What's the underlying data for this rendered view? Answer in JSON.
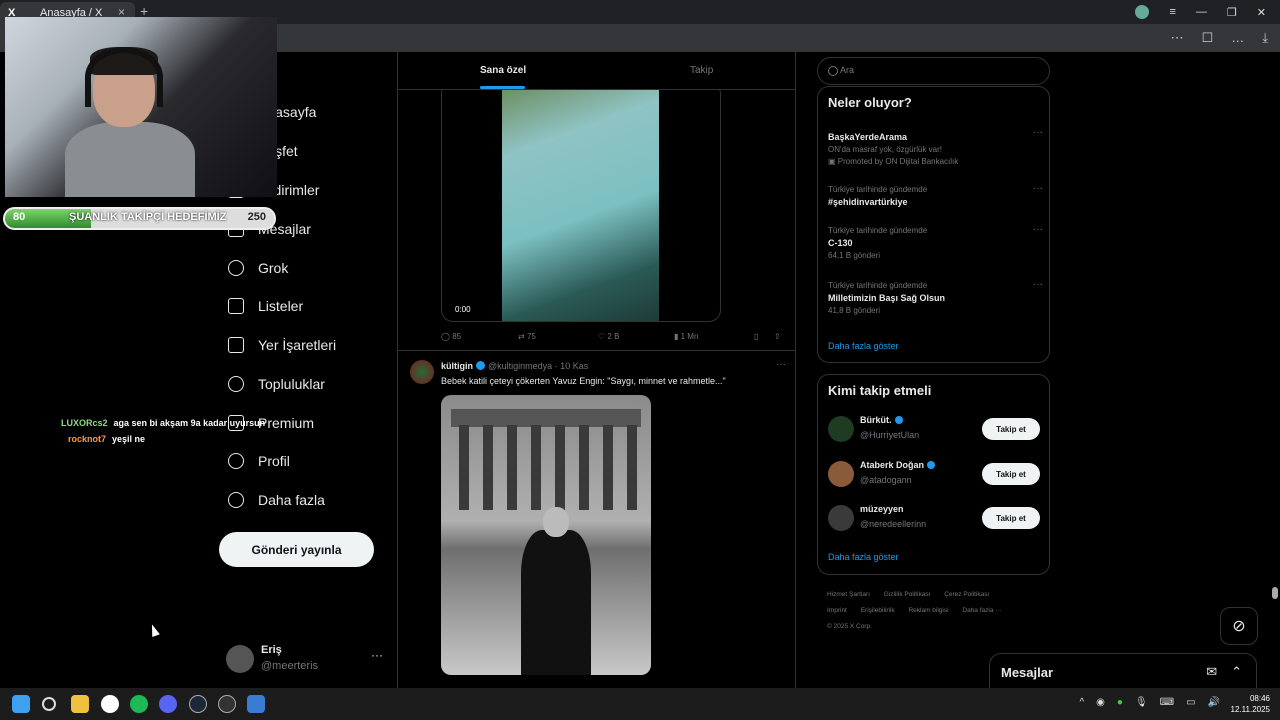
{
  "browser": {
    "tab_title": "Anasayfa / X",
    "tab_logo": "X",
    "tab_close": "×",
    "new_tab": "+",
    "window_controls": [
      "≡",
      "—",
      "❐",
      "✕"
    ],
    "address_icons": [
      "⋯",
      "bookmark-icon",
      "…",
      "⤓"
    ]
  },
  "overlay": {
    "goal": {
      "start": "80",
      "label": "ŞUANLIK TAKİPÇİ HEDEFİMİZ",
      "end": "250",
      "progress_fraction": 0.32
    },
    "chat": [
      {
        "user": "LUXORcs2",
        "user_color": "#8fd98b",
        "message": "aga sen bi akşam 9a kadar uyursun"
      },
      {
        "user": "rocknot7",
        "user_color": "#ff9a3c",
        "message": "yeşil ne"
      }
    ]
  },
  "nav": {
    "items": [
      {
        "label": "Anasayfa",
        "icon": "home-icon"
      },
      {
        "label": "Keşfet",
        "icon": "search-icon"
      },
      {
        "label": "Bildirimler",
        "icon": "bell-icon"
      },
      {
        "label": "Mesajlar",
        "icon": "mail-icon"
      },
      {
        "label": "Grok",
        "icon": "grok-icon"
      },
      {
        "label": "Listeler",
        "icon": "list-icon"
      },
      {
        "label": "Yer İşaretleri",
        "icon": "bookmark-icon"
      },
      {
        "label": "Topluluklar",
        "icon": "communities-icon"
      },
      {
        "label": "Premium",
        "icon": "x-icon"
      },
      {
        "label": "Profil",
        "icon": "person-icon"
      },
      {
        "label": "Daha fazla",
        "icon": "more-circle-icon"
      }
    ],
    "post_button": "Gönderi yayınla",
    "profile": {
      "name": "Eriş",
      "handle": "@meerteris",
      "more": "···"
    }
  },
  "feed": {
    "tabs": {
      "for_you": "Sana özel",
      "following": "Takip"
    },
    "tweet1": {
      "video_time": "0:00",
      "replies": "85",
      "retweets": "75",
      "likes": "2 B",
      "views": "1 Mn"
    },
    "tweet2": {
      "name": "kültigin",
      "handle": "@kultiginmedya",
      "date": "· 10 Kas",
      "text": "Bebek katili çeteyi çökerten Yavuz Engin: \"Saygı, minnet ve rahmetle...\"",
      "more": "···"
    }
  },
  "sidebar": {
    "search_placeholder": "Ara",
    "trends_title": "Neler oluyor?",
    "trends": [
      {
        "context": "",
        "name": "BaşkaYerdeArama",
        "sub": "ON'da masraf yok, özgürlük var!",
        "promoted": "Promoted by ON Dijital Bankacılık"
      },
      {
        "context": "Türkiye tarihinde gündemde",
        "name": "#şehidinvartürkiye",
        "sub": ""
      },
      {
        "context": "Türkiye tarihinde gündemde",
        "name": "C-130",
        "sub": "64,1 B gönderi"
      },
      {
        "context": "Türkiye tarihinde gündemde",
        "name": "Milletimizin Başı Sağ Olsun",
        "sub": "41,8 B gönderi"
      }
    ],
    "trends_more": "Daha fazla göster",
    "follow_title": "Kimi takip etmeli",
    "follow": [
      {
        "name": "Bürküt.",
        "handle": "@HurriyetUlan",
        "verified": true,
        "button": "Takip et"
      },
      {
        "name": "Ataberk Doğan",
        "handle": "@atadogann",
        "verified": true,
        "button": "Takip et"
      },
      {
        "name": "müzeyyen",
        "handle": "@neredeellerinn",
        "verified": false,
        "button": "Takip et"
      }
    ],
    "follow_more": "Daha fazla göster",
    "footer": [
      "Hizmet Şartları",
      "Gizlilik Politikası",
      "Çerez Politikası",
      "Imprint",
      "Erişilebilirlik",
      "Reklam bilgisi",
      "Daha fazla ···",
      "© 2025 X Corp."
    ]
  },
  "messages_drawer": {
    "title": "Mesajlar"
  },
  "taskbar": {
    "time": "08:46",
    "date": "12.11.2025"
  }
}
